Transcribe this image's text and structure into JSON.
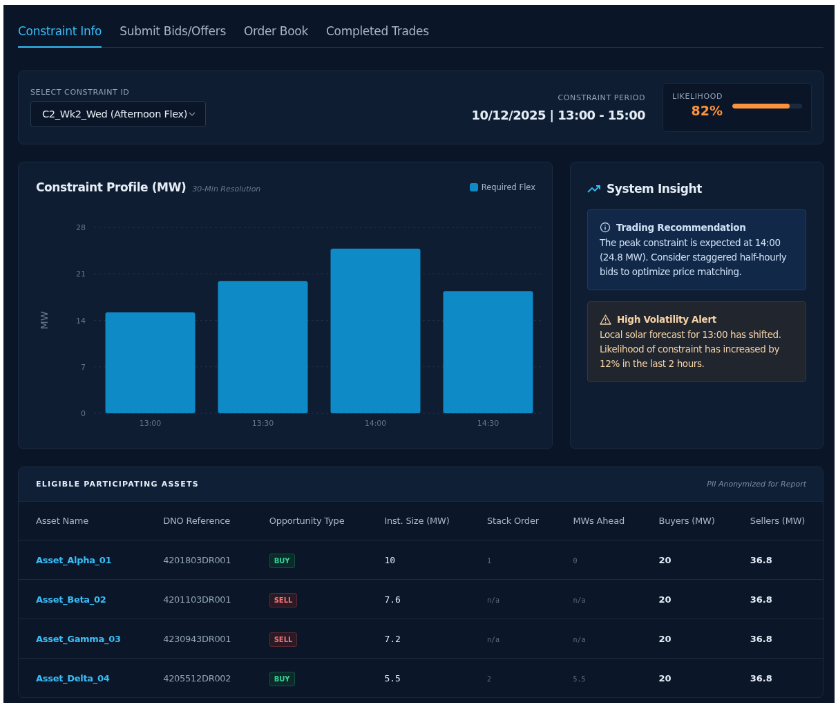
{
  "tabs": [
    {
      "label": "Constraint Info",
      "selected": true
    },
    {
      "label": "Submit Bids/Offers",
      "selected": false
    },
    {
      "label": "Order Book",
      "selected": false
    },
    {
      "label": "Completed Trades",
      "selected": false
    }
  ],
  "selector": {
    "label": "SELECT CONSTRAINT ID",
    "value": "C2_Wk2_Wed (Afternoon Flex)"
  },
  "period": {
    "label": "CONSTRAINT PERIOD",
    "value": "10/12/2025 | 13:00 - 15:00"
  },
  "likelihood": {
    "label": "LIKELIHOOD",
    "value": "82%",
    "level": 0.82
  },
  "profile": {
    "title": "Constraint Profile (MW)",
    "subtitle": "30-Min Resolution",
    "chart_data": {
      "type": "bar",
      "ylabel": "MW",
      "categories": [
        "13:00",
        "13:30",
        "14:00",
        "14:30"
      ],
      "series": [
        {
          "name": "Required Flex",
          "color": "#0e8ac7",
          "values": [
            15.2,
            19.9,
            24.8,
            18.4
          ]
        }
      ],
      "ylim": [
        0,
        28
      ],
      "grid": true,
      "yticks": [
        0,
        7,
        14,
        21,
        28
      ]
    }
  },
  "insight": {
    "title": "System Insight",
    "alerts": [
      {
        "kind": "info",
        "title": "Trading Recommendation",
        "text": "The peak constraint is expected at 14:00 (24.8 MW). Consider staggered half-hourly bids to optimize price matching."
      },
      {
        "kind": "warning",
        "title": "High Volatility Alert",
        "text": "Local solar forecast for 13:00 has shifted. Likelihood of constraint has increased by 12% in the last 2 hours."
      }
    ]
  },
  "assets": {
    "title": "ELIGIBLE PARTICIPATING ASSETS",
    "note": "PII Anonymized for Report",
    "columns": [
      "Asset Name",
      "DNO Reference",
      "Opportunity Type",
      "Inst. Size (MW)",
      "Stack Order",
      "MWs Ahead",
      "Buyers (MW)",
      "Sellers (MW)"
    ],
    "rows": [
      {
        "name": "Asset_Alpha_01",
        "dno": "4201803DR001",
        "type": {
          "label": "BUY",
          "kind": "buy"
        },
        "size": "10",
        "stack": "1",
        "ahead": "0",
        "buyers": "20",
        "sellers": "36.8"
      },
      {
        "name": "Asset_Beta_02",
        "dno": "4201103DR001",
        "type": {
          "label": "SELL",
          "kind": "sell"
        },
        "size": "7.6",
        "stack": "n/a",
        "ahead": "n/a",
        "buyers": "20",
        "sellers": "36.8"
      },
      {
        "name": "Asset_Gamma_03",
        "dno": "4230943DR001",
        "type": {
          "label": "SELL",
          "kind": "sell"
        },
        "size": "7.2",
        "stack": "n/a",
        "ahead": "n/a",
        "buyers": "20",
        "sellers": "36.8"
      },
      {
        "name": "Asset_Delta_04",
        "dno": "4205512DR002",
        "type": {
          "label": "BUY",
          "kind": "buy"
        },
        "size": "5.5",
        "stack": "2",
        "ahead": "5.5",
        "buyers": "20",
        "sellers": "36.8"
      }
    ]
  }
}
